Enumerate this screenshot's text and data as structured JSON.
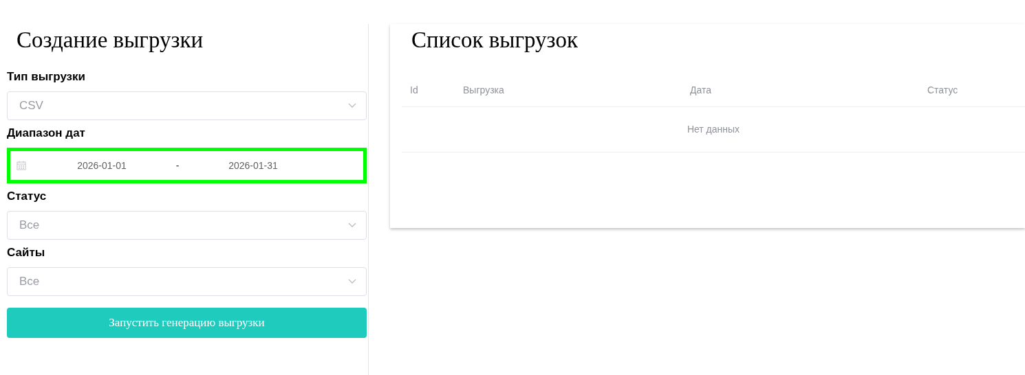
{
  "create_panel": {
    "title": "Создание выгрузки",
    "fields": [
      {
        "kind": "select",
        "label": "Тип выгрузки",
        "value": "CSV"
      },
      {
        "kind": "daterange",
        "label": "Диапазон дат",
        "start": "2026-01-01",
        "separator": "-",
        "end": "2026-01-31",
        "focused": true
      },
      {
        "kind": "select",
        "label": "Статус",
        "value": "Все"
      },
      {
        "kind": "select",
        "label": "Сайты",
        "value": "Все"
      }
    ],
    "submit_button": "Запустить генерацию выгрузки"
  },
  "list_panel": {
    "title": "Список выгрузок",
    "table": {
      "columns": [
        "Id",
        "Выгрузка",
        "Дата",
        "Статус"
      ],
      "empty_text": "Нет данных"
    }
  }
}
